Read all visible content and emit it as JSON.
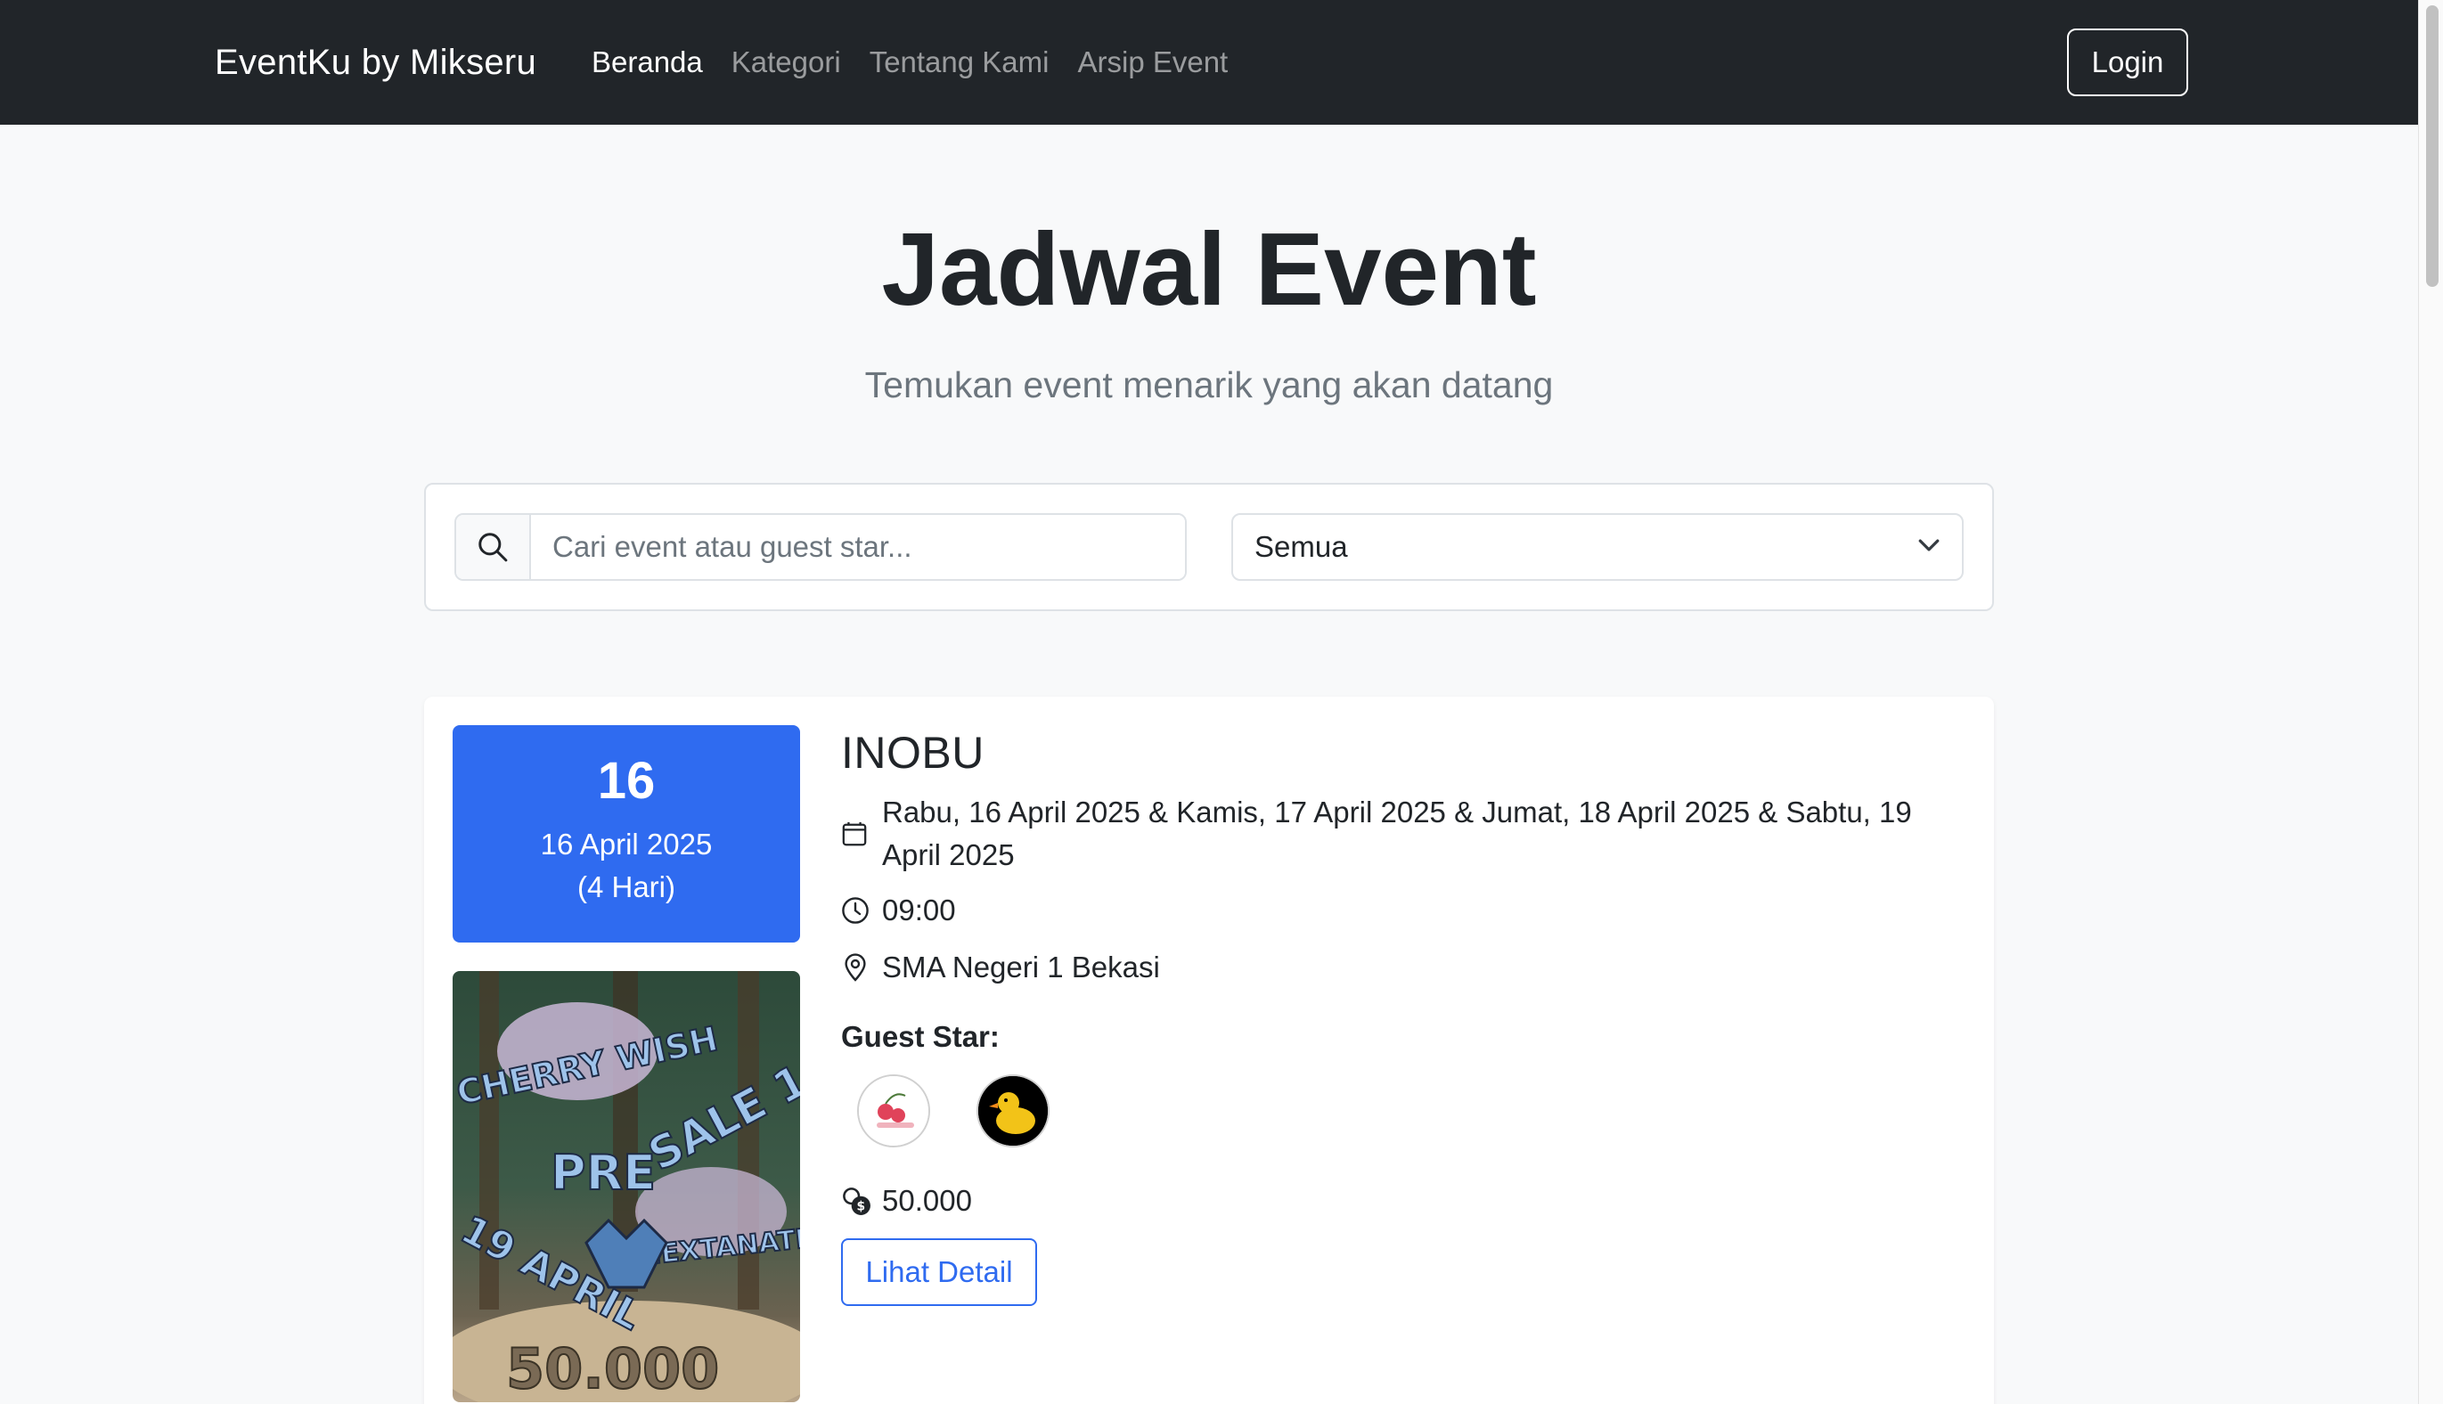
{
  "navbar": {
    "brand": "EventKu by Mikseru",
    "links": [
      {
        "label": "Beranda",
        "active": true
      },
      {
        "label": "Kategori",
        "active": false
      },
      {
        "label": "Tentang Kami",
        "active": false
      },
      {
        "label": "Arsip Event",
        "active": false
      }
    ],
    "login_label": "Login"
  },
  "hero": {
    "title": "Jadwal Event",
    "subtitle": "Temukan event menarik yang akan datang"
  },
  "filter": {
    "search_placeholder": "Cari event atau guest star...",
    "search_icon": "search-icon",
    "category_selected": "Semua"
  },
  "event": {
    "day": "16",
    "date_full": "16 April 2025",
    "duration": "(4 Hari)",
    "title": "INOBU",
    "dates": "Rabu, 16 April 2025 & Kamis, 17 April 2025 & Jumat, 18 April 2025 & Sabtu, 19 April 2025",
    "time": "09:00",
    "location": "SMA Negeri 1 Bekasi",
    "guest_label": "Guest Star:",
    "guests": [
      "Cherry Wish",
      "Nextanative"
    ],
    "price": "50.000",
    "detail_label": "Lihat Detail",
    "poster_texts": {
      "line1": "CHERRY WISH",
      "line2": "PRE",
      "line3": "SALE 1",
      "line4": "19 APRIL",
      "line5": "NEXTANATIVE",
      "line6": "50.000"
    }
  },
  "colors": {
    "navbar_bg": "#212529",
    "primary": "#2f6bf0",
    "page_bg": "#f8f9fa"
  }
}
